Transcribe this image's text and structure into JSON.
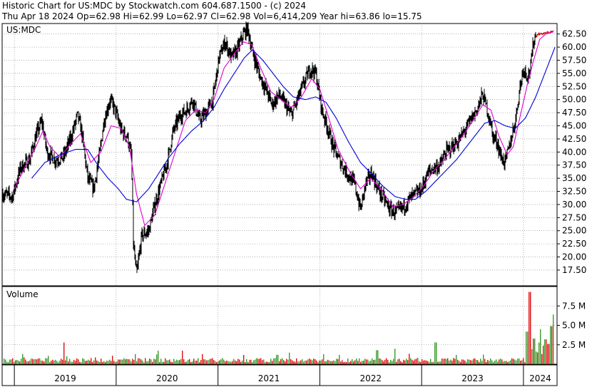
{
  "header": {
    "line1": "Historic Chart for US:MDC by Stockwatch.com 604.687.1500 - (c) 2024",
    "line2": "Thu Apr 18 2024   Op=62.98   Hi=62.99   Lo=62.97   Cl=62.98   Vol=6,414,209   Year hi=63.86   lo=15.75"
  },
  "chart_data": [
    {
      "type": "line",
      "label": "US:MDC",
      "ylim": [
        14.5,
        64.5
      ],
      "y_ticks": [
        "62.50",
        "60.00",
        "57.50",
        "55.00",
        "52.50",
        "50.00",
        "47.50",
        "45.00",
        "42.50",
        "40.00",
        "37.50",
        "35.00",
        "32.50",
        "30.00",
        "27.50",
        "25.00",
        "22.50",
        "20.00",
        "17.50"
      ],
      "x_ticks": [
        "2019",
        "2020",
        "2021",
        "2022",
        "2023",
        "2024"
      ],
      "xlim": [
        2018.88,
        2024.33
      ],
      "price_anchors": [
        [
          2018.88,
          32.0
        ],
        [
          2018.98,
          31.5
        ],
        [
          2019.06,
          37.0
        ],
        [
          2019.15,
          38.5
        ],
        [
          2019.21,
          43.0
        ],
        [
          2019.27,
          46.0
        ],
        [
          2019.32,
          40.0
        ],
        [
          2019.4,
          38.5
        ],
        [
          2019.48,
          39.0
        ],
        [
          2019.56,
          43.0
        ],
        [
          2019.62,
          47.0
        ],
        [
          2019.66,
          44.0
        ],
        [
          2019.72,
          35.0
        ],
        [
          2019.78,
          33.0
        ],
        [
          2019.84,
          40.0
        ],
        [
          2019.88,
          46.0
        ],
        [
          2019.94,
          50.0
        ],
        [
          2019.99,
          48.0
        ],
        [
          2020.05,
          44.0
        ],
        [
          2020.11,
          43.0
        ],
        [
          2020.15,
          39.0
        ],
        [
          2020.17,
          22.0
        ],
        [
          2020.2,
          16.5
        ],
        [
          2020.25,
          24.0
        ],
        [
          2020.32,
          25.0
        ],
        [
          2020.38,
          30.0
        ],
        [
          2020.44,
          34.0
        ],
        [
          2020.5,
          38.0
        ],
        [
          2020.56,
          44.0
        ],
        [
          2020.63,
          47.0
        ],
        [
          2020.69,
          48.0
        ],
        [
          2020.75,
          50.0
        ],
        [
          2020.82,
          46.0
        ],
        [
          2020.88,
          47.5
        ],
        [
          2020.95,
          50.0
        ],
        [
          2021.01,
          58.0
        ],
        [
          2021.07,
          61.0
        ],
        [
          2021.13,
          58.0
        ],
        [
          2021.19,
          59.5
        ],
        [
          2021.25,
          62.5
        ],
        [
          2021.29,
          63.5
        ],
        [
          2021.34,
          59.0
        ],
        [
          2021.41,
          54.5
        ],
        [
          2021.47,
          52.0
        ],
        [
          2021.53,
          49.0
        ],
        [
          2021.6,
          51.0
        ],
        [
          2021.66,
          49.0
        ],
        [
          2021.72,
          47.0
        ],
        [
          2021.78,
          50.0
        ],
        [
          2021.84,
          53.0
        ],
        [
          2021.91,
          56.0
        ],
        [
          2021.96,
          55.0
        ],
        [
          2022.02,
          48.0
        ],
        [
          2022.07,
          45.0
        ],
        [
          2022.13,
          41.0
        ],
        [
          2022.19,
          38.5
        ],
        [
          2022.25,
          36.5
        ],
        [
          2022.3,
          35.0
        ],
        [
          2022.34,
          34.0
        ],
        [
          2022.4,
          29.0
        ],
        [
          2022.45,
          34.0
        ],
        [
          2022.51,
          36.0
        ],
        [
          2022.57,
          33.0
        ],
        [
          2022.63,
          31.0
        ],
        [
          2022.69,
          29.0
        ],
        [
          2022.75,
          28.5
        ],
        [
          2022.82,
          29.5
        ],
        [
          2022.88,
          31.0
        ],
        [
          2022.94,
          32.0
        ],
        [
          2023.0,
          33.0
        ],
        [
          2023.06,
          36.0
        ],
        [
          2023.12,
          37.0
        ],
        [
          2023.18,
          37.5
        ],
        [
          2023.24,
          40.0
        ],
        [
          2023.3,
          41.0
        ],
        [
          2023.36,
          42.0
        ],
        [
          2023.42,
          44.0
        ],
        [
          2023.48,
          46.0
        ],
        [
          2023.54,
          48.0
        ],
        [
          2023.6,
          51.0
        ],
        [
          2023.66,
          47.0
        ],
        [
          2023.7,
          43.0
        ],
        [
          2023.74,
          42.0
        ],
        [
          2023.78,
          39.0
        ],
        [
          2023.82,
          38.0
        ],
        [
          2023.86,
          41.0
        ],
        [
          2023.92,
          46.0
        ],
        [
          2023.97,
          53.0
        ],
        [
          2024.0,
          56.0
        ],
        [
          2024.04,
          54.5
        ],
        [
          2024.07,
          56.0
        ],
        [
          2024.1,
          61.5
        ],
        [
          2024.14,
          62.5
        ],
        [
          2024.2,
          62.6
        ],
        [
          2024.29,
          62.98
        ]
      ],
      "ma_short_anchors": [
        [
          2019.0,
          33.0
        ],
        [
          2019.1,
          37.0
        ],
        [
          2019.2,
          40.5
        ],
        [
          2019.28,
          44.0
        ],
        [
          2019.35,
          41.0
        ],
        [
          2019.45,
          39.0
        ],
        [
          2019.55,
          41.5
        ],
        [
          2019.65,
          43.5
        ],
        [
          2019.75,
          38.0
        ],
        [
          2019.85,
          40.0
        ],
        [
          2019.95,
          45.0
        ],
        [
          2020.05,
          44.5
        ],
        [
          2020.13,
          41.0
        ],
        [
          2020.2,
          32.0
        ],
        [
          2020.28,
          26.0
        ],
        [
          2020.38,
          28.0
        ],
        [
          2020.48,
          34.0
        ],
        [
          2020.58,
          40.0
        ],
        [
          2020.68,
          46.0
        ],
        [
          2020.78,
          48.0
        ],
        [
          2020.88,
          47.5
        ],
        [
          2020.96,
          50.0
        ],
        [
          2021.06,
          56.0
        ],
        [
          2021.15,
          58.5
        ],
        [
          2021.25,
          61.0
        ],
        [
          2021.33,
          60.5
        ],
        [
          2021.42,
          56.0
        ],
        [
          2021.52,
          51.5
        ],
        [
          2021.62,
          50.0
        ],
        [
          2021.72,
          48.5
        ],
        [
          2021.82,
          50.5
        ],
        [
          2021.92,
          54.0
        ],
        [
          2022.0,
          52.0
        ],
        [
          2022.08,
          47.0
        ],
        [
          2022.18,
          40.5
        ],
        [
          2022.3,
          36.0
        ],
        [
          2022.4,
          33.0
        ],
        [
          2022.5,
          35.0
        ],
        [
          2022.6,
          33.0
        ],
        [
          2022.72,
          29.5
        ],
        [
          2022.82,
          30.0
        ],
        [
          2022.92,
          31.5
        ],
        [
          2023.02,
          33.5
        ],
        [
          2023.12,
          36.5
        ],
        [
          2023.22,
          38.5
        ],
        [
          2023.32,
          41.0
        ],
        [
          2023.42,
          43.5
        ],
        [
          2023.52,
          46.5
        ],
        [
          2023.6,
          49.0
        ],
        [
          2023.68,
          48.0
        ],
        [
          2023.76,
          43.0
        ],
        [
          2023.84,
          39.5
        ],
        [
          2023.9,
          41.0
        ],
        [
          2023.97,
          47.0
        ],
        [
          2024.04,
          53.0
        ],
        [
          2024.1,
          57.5
        ],
        [
          2024.16,
          61.5
        ],
        [
          2024.22,
          62.5
        ],
        [
          2024.29,
          62.9
        ]
      ],
      "ma_long_anchors": [
        [
          2019.17,
          35.0
        ],
        [
          2019.3,
          38.0
        ],
        [
          2019.45,
          39.5
        ],
        [
          2019.6,
          40.5
        ],
        [
          2019.72,
          40.5
        ],
        [
          2019.82,
          37.5
        ],
        [
          2019.92,
          35.0
        ],
        [
          2020.02,
          33.0
        ],
        [
          2020.1,
          31.0
        ],
        [
          2020.2,
          30.5
        ],
        [
          2020.32,
          33.0
        ],
        [
          2020.42,
          36.0
        ],
        [
          2020.52,
          39.0
        ],
        [
          2020.62,
          41.5
        ],
        [
          2020.74,
          44.0
        ],
        [
          2020.86,
          46.0
        ],
        [
          2020.96,
          48.5
        ],
        [
          2021.06,
          52.0
        ],
        [
          2021.16,
          55.0
        ],
        [
          2021.26,
          58.0
        ],
        [
          2021.34,
          59.5
        ],
        [
          2021.44,
          57.5
        ],
        [
          2021.54,
          55.0
        ],
        [
          2021.64,
          52.5
        ],
        [
          2021.74,
          50.5
        ],
        [
          2021.86,
          50.0
        ],
        [
          2021.96,
          50.5
        ],
        [
          2022.06,
          49.5
        ],
        [
          2022.16,
          46.5
        ],
        [
          2022.28,
          42.0
        ],
        [
          2022.4,
          38.0
        ],
        [
          2022.5,
          36.0
        ],
        [
          2022.62,
          33.5
        ],
        [
          2022.74,
          31.5
        ],
        [
          2022.84,
          31.0
        ],
        [
          2022.94,
          31.0
        ],
        [
          2023.04,
          32.5
        ],
        [
          2023.14,
          34.5
        ],
        [
          2023.24,
          36.5
        ],
        [
          2023.34,
          38.5
        ],
        [
          2023.44,
          41.0
        ],
        [
          2023.54,
          43.5
        ],
        [
          2023.62,
          45.5
        ],
        [
          2023.72,
          46.0
        ],
        [
          2023.82,
          45.0
        ],
        [
          2023.92,
          44.5
        ],
        [
          2024.02,
          46.5
        ],
        [
          2024.12,
          50.5
        ],
        [
          2024.22,
          55.5
        ],
        [
          2024.31,
          60.0
        ]
      ]
    },
    {
      "type": "bar",
      "label": "Volume",
      "ylim": [
        0,
        10000000
      ],
      "y_ticks": [
        "7.5 M",
        "5.0 M",
        "2.5 M"
      ],
      "spike_anchors": [
        [
          2024.06,
          9.3
        ],
        [
          2024.03,
          4.2
        ],
        [
          2024.1,
          3.3
        ],
        [
          2024.16,
          4.5
        ],
        [
          2024.21,
          3.2
        ],
        [
          2024.27,
          4.9
        ],
        [
          2024.29,
          6.4
        ],
        [
          2024.24,
          2.6
        ],
        [
          2023.13,
          2.8
        ],
        [
          2022.56,
          1.8
        ],
        [
          2022.73,
          2.0
        ],
        [
          2021.58,
          1.2
        ],
        [
          2019.48,
          2.8
        ],
        [
          2020.18,
          1.3
        ]
      ]
    }
  ],
  "colors": {
    "price": "#000000",
    "ma_short": "#e000d0",
    "ma_long": "#0000d8",
    "volume_up": "#3a9a2a",
    "volume_down": "#e01010",
    "grid": "#808080"
  }
}
